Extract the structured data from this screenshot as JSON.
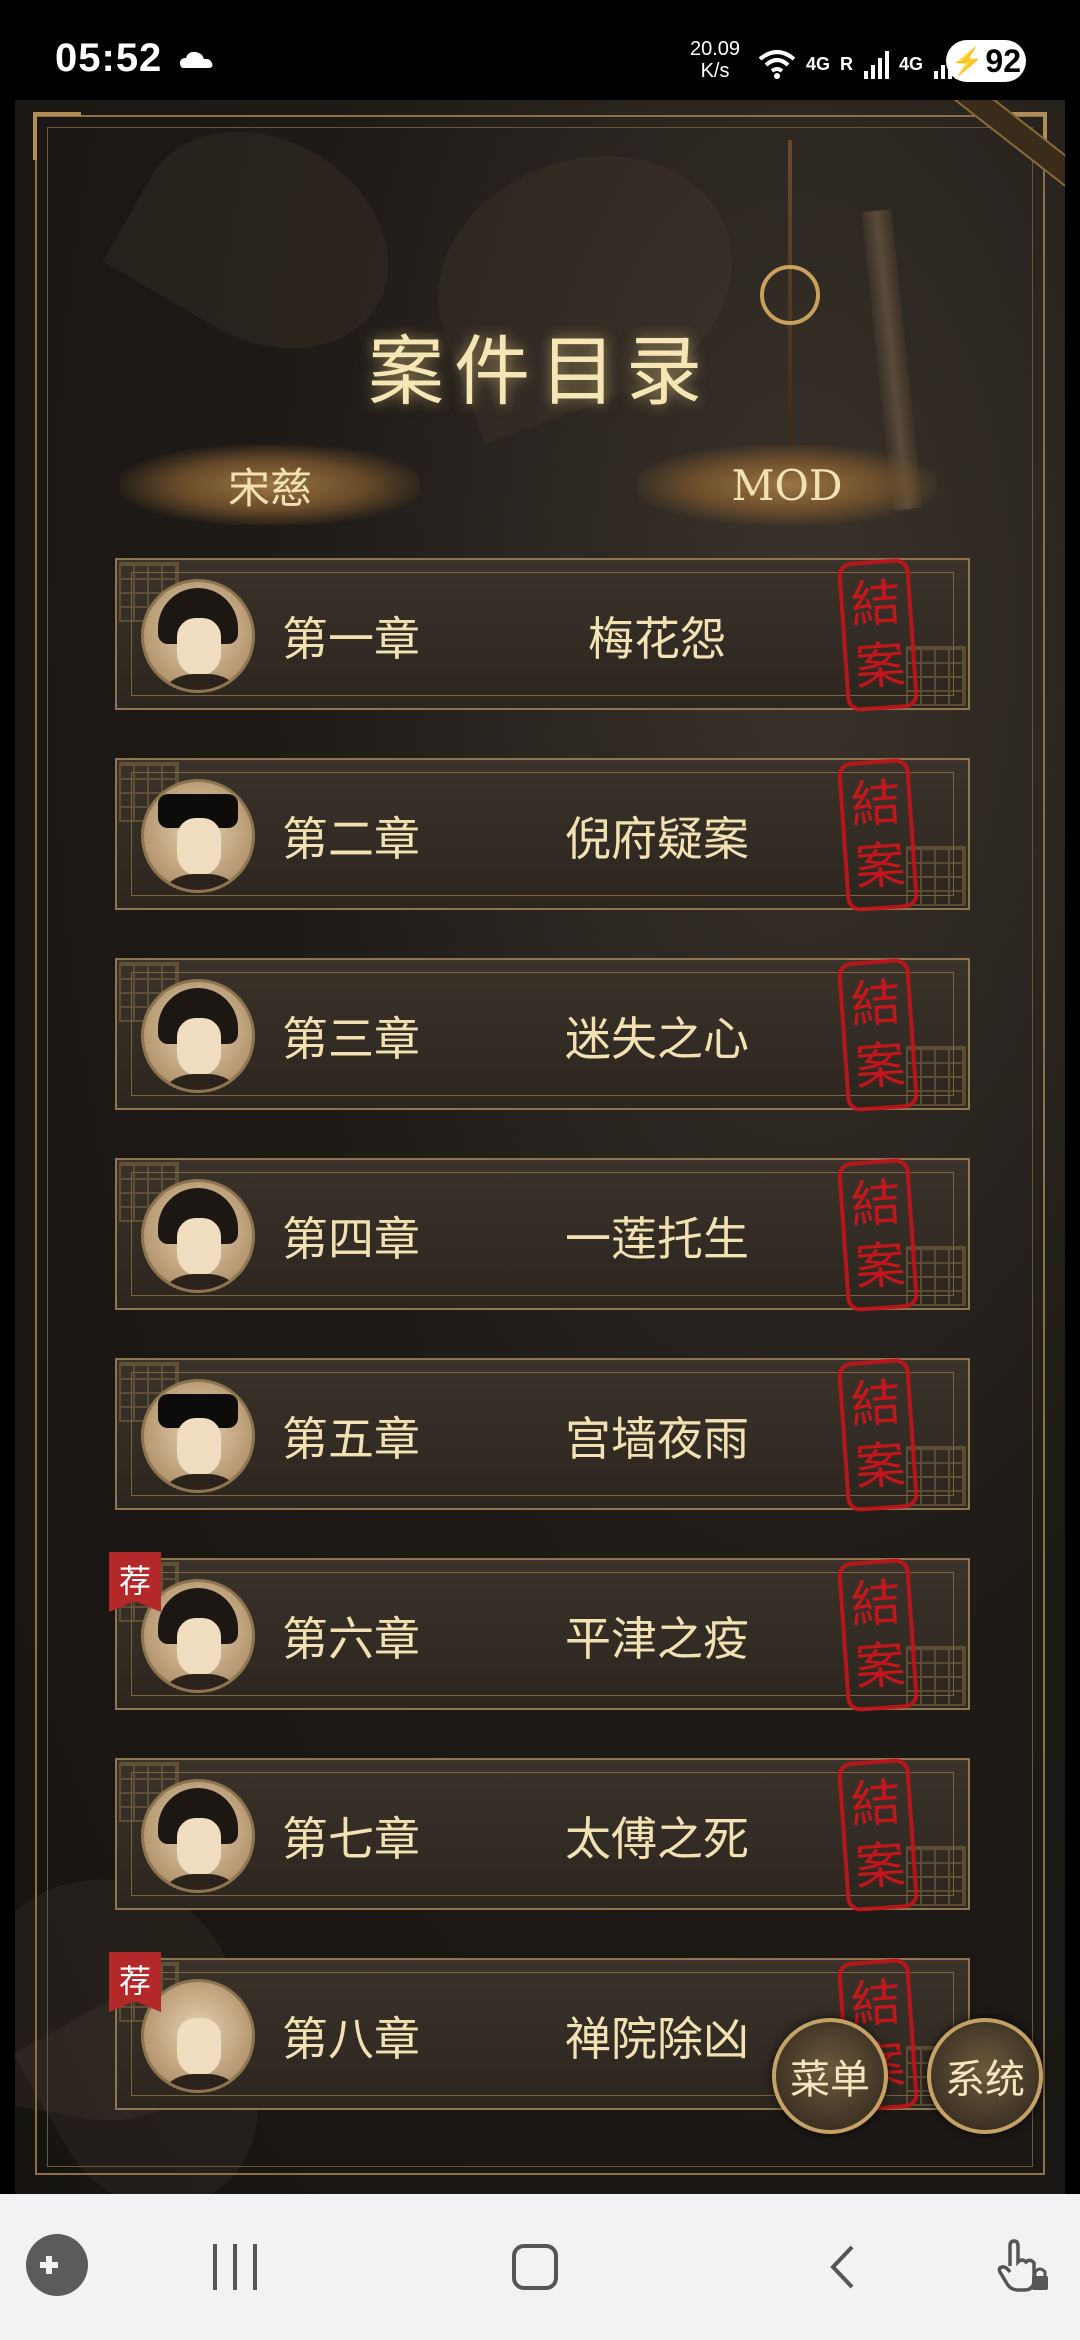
{
  "status_bar": {
    "time": "05:52",
    "network_speed_value": "20.09",
    "network_speed_unit": "K/s",
    "network_label_1": "4G",
    "network_label_2": "R",
    "network_label_3": "4G",
    "battery": "92"
  },
  "page": {
    "title": "案件目录",
    "tabs": [
      {
        "label": "宋慈"
      },
      {
        "label": "MOD"
      }
    ]
  },
  "chapters": [
    {
      "number": "第一章",
      "name": "梅花怨",
      "stamp": [
        "結",
        "案"
      ],
      "recommended": false,
      "portrait": "scholar-portrait"
    },
    {
      "number": "第二章",
      "name": "倪府疑案",
      "stamp": [
        "結",
        "案"
      ],
      "recommended": false,
      "portrait": "bearded-official-portrait"
    },
    {
      "number": "第三章",
      "name": "迷失之心",
      "stamp": [
        "結",
        "案"
      ],
      "recommended": false,
      "portrait": "young-man-portrait"
    },
    {
      "number": "第四章",
      "name": "一莲托生",
      "stamp": [
        "結",
        "案"
      ],
      "recommended": false,
      "portrait": "lady-portrait"
    },
    {
      "number": "第五章",
      "name": "宫墙夜雨",
      "stamp": [
        "結",
        "案"
      ],
      "recommended": false,
      "portrait": "guard-portrait"
    },
    {
      "number": "第六章",
      "name": "平津之疫",
      "stamp": [
        "結",
        "案"
      ],
      "recommended": true,
      "recommend_label": "荐",
      "portrait": "youth-portrait"
    },
    {
      "number": "第七章",
      "name": "太傅之死",
      "stamp": [
        "結",
        "案"
      ],
      "recommended": false,
      "portrait": "long-hair-man-portrait"
    },
    {
      "number": "第八章",
      "name": "禅院除凶",
      "stamp": [
        "結",
        "案"
      ],
      "recommended": true,
      "recommend_label": "荐",
      "portrait": "monk-portrait"
    }
  ],
  "floating_buttons": {
    "menu": "菜单",
    "system": "系统"
  },
  "colors": {
    "title_gold": "#f6e6b5",
    "stamp_red": "#c2141a",
    "frame_gold": "#8c7550"
  }
}
